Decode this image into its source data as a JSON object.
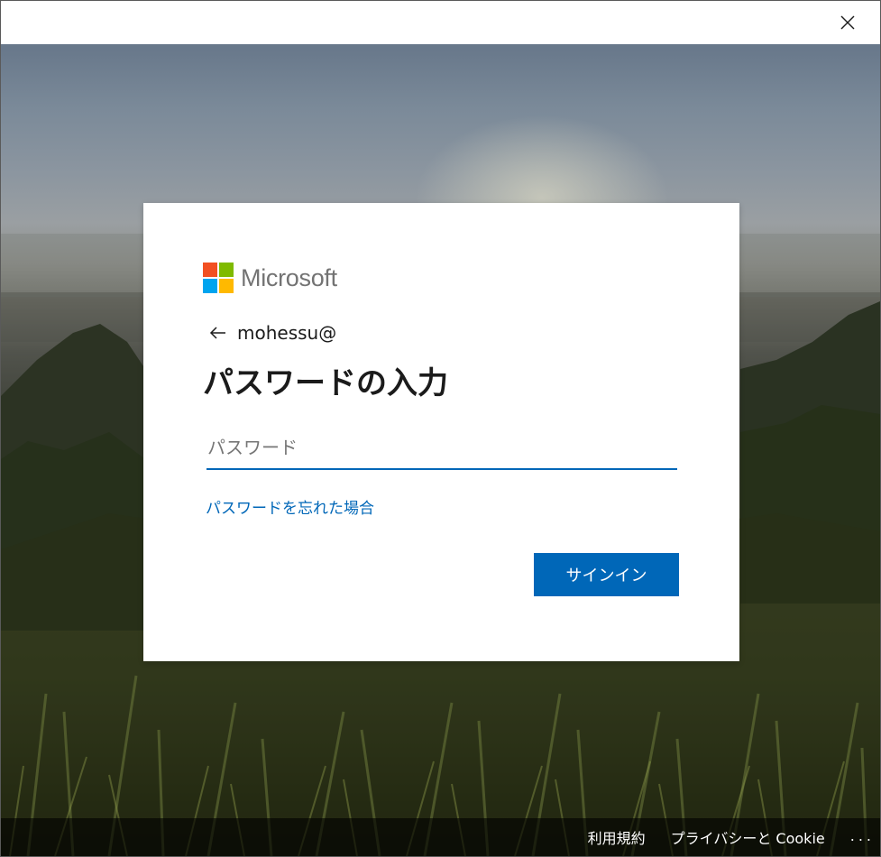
{
  "window": {
    "close_icon": "close-icon"
  },
  "logo": {
    "text": "Microsoft",
    "colors": [
      "#f25022",
      "#7fba00",
      "#00a4ef",
      "#ffb900"
    ]
  },
  "identity": {
    "back_icon": "back-arrow-icon",
    "email": "mohessu@"
  },
  "title": "パスワードの入力",
  "password": {
    "value": "",
    "placeholder": "パスワード"
  },
  "forgot_link": "パスワードを忘れた場合",
  "signin_button": "サインイン",
  "footer": {
    "terms": "利用規約",
    "privacy": "プライバシーと Cookie",
    "more": "..."
  },
  "colors": {
    "accent": "#0067b8",
    "text": "#1b1b1b",
    "placeholder": "#767676"
  }
}
